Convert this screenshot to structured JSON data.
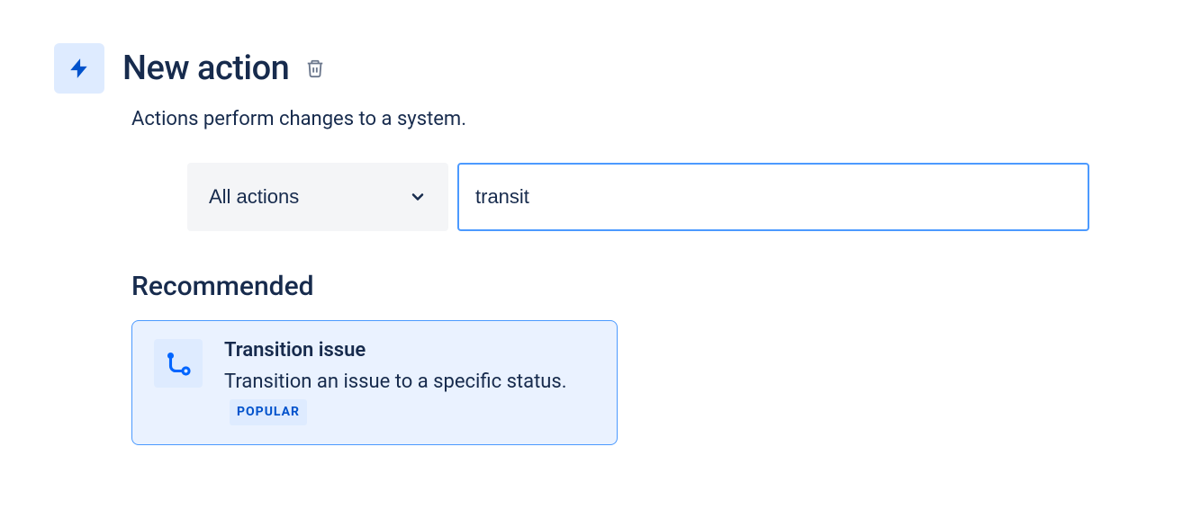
{
  "header": {
    "title": "New action",
    "subtitle": "Actions perform changes to a system."
  },
  "filter": {
    "dropdown_label": "All actions",
    "search_value": "transit"
  },
  "section": {
    "heading": "Recommended"
  },
  "card": {
    "title": "Transition issue",
    "description": "Transition an issue to a specific status.",
    "badge": "POPULAR"
  }
}
